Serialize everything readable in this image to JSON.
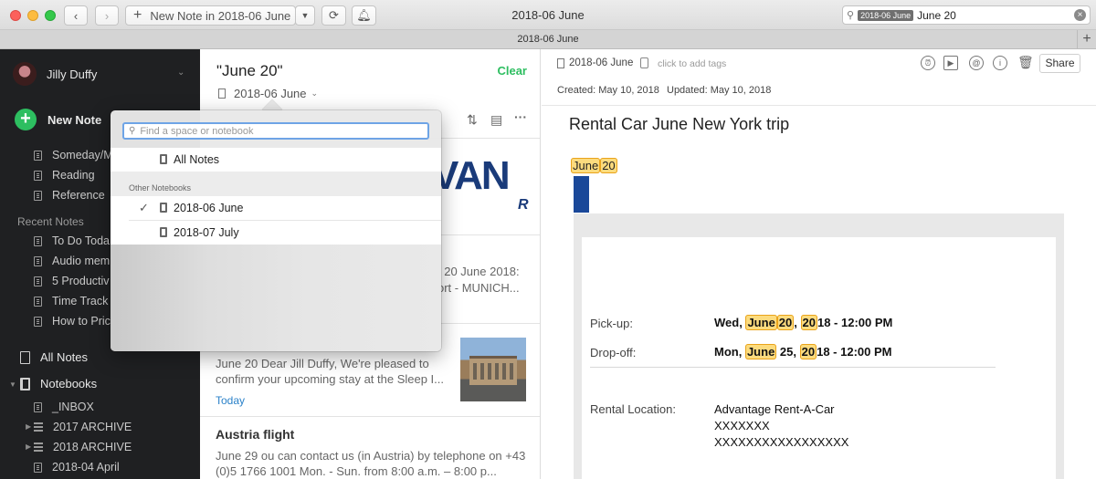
{
  "window": {
    "title": "2018-06 June",
    "new_note_label": "New Note in 2018-06 June",
    "search_token": "2018-06 June",
    "search_text": "June 20",
    "tab_label": "2018-06 June"
  },
  "sidebar": {
    "account_name": "Jilly Duffy",
    "new_note_label": "New Note",
    "shortcuts": [
      "Someday/M",
      "Reading",
      "Reference"
    ],
    "recent_heading": "Recent Notes",
    "recent": [
      "To Do Toda",
      "Audio mem",
      "5 Productiv",
      "Time Track",
      "How to Pric"
    ],
    "all_notes": "All Notes",
    "notebooks": "Notebooks",
    "notebook_items": [
      "_INBOX",
      "2017 ARCHIVE",
      "2018 ARCHIVE",
      "2018-04 April"
    ]
  },
  "notelist": {
    "search_title": "\"June 20\"",
    "clear_label": "Clear",
    "notebook": "2018-06 June",
    "card1_logo_text": "VAN",
    "card1_logo_sub": "R",
    "card1_snippet_line1": ". 20 June 2018:",
    "card1_snippet_line2": "ort - MUNICH...",
    "card2_snippet": "June 20 Dear Jill Duffy, We're pleased to confirm your upcoming stay at the Sleep I...",
    "card2_date": "Today",
    "card3_title": "Austria flight",
    "card3_snippet": "June 29 ou can contact us (in Austria) by telephone on +43 (0)5 1766 1001 Mon. - Sun. from 8:00 a.m. – 8:00 p..."
  },
  "popover": {
    "search_placeholder": "Find a space or notebook",
    "all_notes": "All Notes",
    "section_heading": "Other Notebooks",
    "notebooks": [
      {
        "name": "2018-06 June",
        "checked": "✓"
      },
      {
        "name": "2018-07 July",
        "checked": ""
      }
    ]
  },
  "editor": {
    "notebook": "2018-06 June",
    "tags_placeholder": "click to add tags",
    "share_label": "Share",
    "created": "Created: May 10, 2018",
    "updated": "Updated: May 10, 2018",
    "title": "Rental Car June New York trip",
    "hl_tag_a": "June",
    "hl_tag_b": "20",
    "pickup_label": "Pick-up:",
    "pickup_day": "Wed,",
    "pickup_month": "June",
    "pickup_date": "20",
    "pickup_sep": ",",
    "pickup_year_hl": "20",
    "pickup_rest": "18 - 12:00 PM",
    "dropoff_label": "Drop-off:",
    "dropoff_day": "Mon,",
    "dropoff_month": "June",
    "dropoff_date": "25,",
    "dropoff_year_hl": "20",
    "dropoff_rest": "18 - 12:00 PM",
    "location_label": "Rental Location:",
    "location_line1": "Advantage Rent-A-Car",
    "location_line2": "XXXXXXX",
    "location_line3": "XXXXXXXXXXXXXXXXX"
  },
  "colors": {
    "accent_green": "#2dbe60",
    "sidebar_bg": "#1f2022",
    "highlight": "#fcdb7e",
    "highlight_border": "#e9a31b",
    "link_blue": "#2b82c9"
  }
}
